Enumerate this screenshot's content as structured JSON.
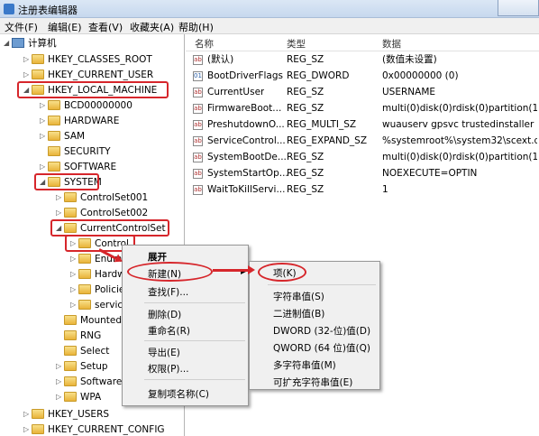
{
  "window": {
    "title": "注册表编辑器"
  },
  "menu": [
    "文件(F)",
    "编辑(E)",
    "查看(V)",
    "收藏夹(A)",
    "帮助(H)"
  ],
  "tree": {
    "root": "计算机",
    "nodes": [
      "HKEY_CLASSES_ROOT",
      "HKEY_CURRENT_USER",
      "HKEY_LOCAL_MACHINE",
      "BCD00000000",
      "HARDWARE",
      "SAM",
      "SECURITY",
      "SOFTWARE",
      "SYSTEM",
      "ControlSet001",
      "ControlSet002",
      "CurrentControlSet",
      "Control",
      "Enum",
      "Hardw",
      "Policie",
      "service",
      "Mounted",
      "RNG",
      "Select",
      "Setup",
      "Software",
      "WPA",
      "HKEY_USERS",
      "HKEY_CURRENT_CONFIG"
    ]
  },
  "columns": {
    "name": "名称",
    "type": "类型",
    "data": "数据"
  },
  "values": [
    {
      "name": "(默认)",
      "type": "REG_SZ",
      "data": "(数值未设置)"
    },
    {
      "name": "BootDriverFlags",
      "type": "REG_DWORD",
      "data": "0x00000000 (0)"
    },
    {
      "name": "CurrentUser",
      "type": "REG_SZ",
      "data": "USERNAME"
    },
    {
      "name": "FirmwareBoot...",
      "type": "REG_SZ",
      "data": "multi(0)disk(0)rdisk(0)partition(1)"
    },
    {
      "name": "PreshutdownO...",
      "type": "REG_MULTI_SZ",
      "data": "wuauserv gpsvc trustedinstaller"
    },
    {
      "name": "ServiceControl...",
      "type": "REG_EXPAND_SZ",
      "data": "%systemroot%\\system32\\scext.dll"
    },
    {
      "name": "SystemBootDe...",
      "type": "REG_SZ",
      "data": "multi(0)disk(0)rdisk(0)partition(1)"
    },
    {
      "name": "SystemStartOp...",
      "type": "REG_SZ",
      "data": " NOEXECUTE=OPTIN"
    },
    {
      "name": "WaitToKillServi...",
      "type": "REG_SZ",
      "data": "1"
    }
  ],
  "context_menu": {
    "expand": "展开",
    "new": "新建(N)",
    "find": "查找(F)...",
    "delete": "删除(D)",
    "rename": "重命名(R)",
    "export": "导出(E)",
    "permissions": "权限(P)...",
    "copy_key_name": "复制项名称(C)"
  },
  "submenu": {
    "key": "项(K)",
    "string": "字符串值(S)",
    "binary": "二进制值(B)",
    "dword": "DWORD (32-位)值(D)",
    "qword": "QWORD (64 位)值(Q)",
    "multi_string": "多字符串值(M)",
    "expandable_string": "可扩充字符串值(E)"
  },
  "colors": {
    "highlight": "#d6262b",
    "menu_bg": "#f0f0f0",
    "folder": "#e9b43a"
  }
}
